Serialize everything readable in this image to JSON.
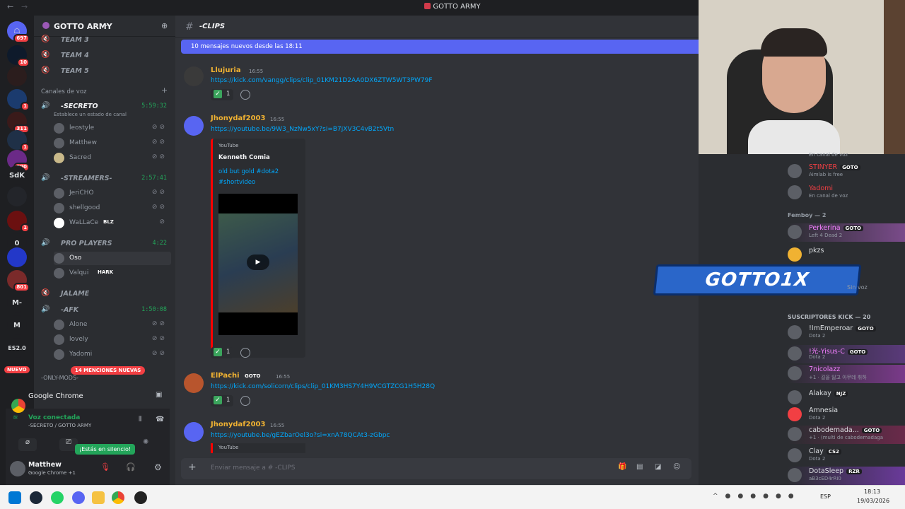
{
  "window": {
    "title": "GOTTO ARMY"
  },
  "rail": {
    "items": [
      {
        "label": "",
        "badge": "697"
      },
      {
        "label": "",
        "badge": "10"
      },
      {
        "label": "",
        "badge": ""
      },
      {
        "label": "",
        "badge": "1"
      },
      {
        "label": "",
        "badge": "311"
      },
      {
        "label": "",
        "badge": "1"
      },
      {
        "label": "",
        "badge": "200"
      },
      {
        "label": "SdK",
        "badge": ""
      },
      {
        "label": "",
        "badge": ""
      },
      {
        "label": "",
        "badge": "1"
      },
      {
        "label": "0",
        "badge": ""
      },
      {
        "label": "",
        "badge": ""
      },
      {
        "label": "",
        "badge": "801"
      },
      {
        "label": "M-",
        "badge": ""
      },
      {
        "label": "M",
        "badge": ""
      },
      {
        "label": "ES2.0",
        "badge": ""
      }
    ],
    "new_badge": "NUEVO"
  },
  "sidebar": {
    "guild_name": "GOTTO ARMY",
    "team_channels": [
      "TEAM 3",
      "TEAM 4",
      "TEAM 5"
    ],
    "voice_category": "Canales de voz",
    "channels": [
      {
        "name": "-SECRETO",
        "time": "5:59:32",
        "status": "Establece un estado de canal",
        "users": [
          "leostyle",
          "Matthew",
          "Sacred"
        ]
      },
      {
        "name": "-STREAMERS-",
        "time": "2:57:41",
        "users": [
          "JeriCHO",
          "shellgood",
          "WaLLaCe"
        ]
      },
      {
        "name": "PRO PLAYERS",
        "time": "4:22",
        "users": [
          "Oso",
          "Valqui"
        ]
      },
      {
        "name": "JALAME",
        "time": "",
        "users": []
      },
      {
        "name": "-AFK",
        "time": "1:50:08",
        "users": [
          "Alone",
          "lovely",
          "Yadomi"
        ]
      }
    ],
    "user_tags": {
      "wallace": "BLZ",
      "valqui": "HARK"
    },
    "mentions_pill": "14 MENCIONES NUEVAS",
    "only_mods": "-ONLY-MODS-"
  },
  "voice_panel": {
    "app": "Google Chrome",
    "status": "Voz conectada",
    "channel": "-SECRETO / GOTTO ARMY",
    "tooltip": "¡Estás en silencio!",
    "username": "Matthew",
    "user_status": "Google Chrome +1"
  },
  "chat": {
    "channel_name": "-CLIPS",
    "new_messages": "10 mensajes nuevos desde las 18:11",
    "messages": [
      {
        "author": "Llujuria",
        "time": "16:55",
        "link": "https://kick.com/vangg/clips/clip_01KM21D2AA0DX6ZTW5WT3PW79F",
        "react_count": "1"
      },
      {
        "author": "Jhonydaf2003",
        "time": "16:55",
        "link": "https://youtube.be/9W3_NzNw5xY?si=B7jXV3C4vB2t5Vtn",
        "react_count": "1"
      },
      {
        "author": "ElPachi",
        "tag": "GOTO",
        "time": "16:55",
        "link": "https://kick.com/solicorn/clips/clip_01KM3HS7Y4H9VCGTZCG1H5H28Q",
        "react_count": "1"
      },
      {
        "author": "Jhonydaf2003",
        "time": "16:55",
        "link": "https://youtube.be/gEZbarOel3o?si=xnA78QCAt3-zGbpc",
        "react_count": ""
      }
    ],
    "embed": {
      "provider": "YouTube",
      "author": "Kenneth Comia",
      "title": "old but gold #dota2 #shortvideo"
    },
    "embed2_provider": "YouTube",
    "composer_placeholder": "Enviar mensaje a # -CLIPS"
  },
  "overlay": {
    "logo_text": "GOTTO1X"
  },
  "members": {
    "top": [
      {
        "name": "",
        "status": "En canal de voz"
      },
      {
        "name": "STINYER",
        "tag": "GOTO",
        "status": "Aimlab is free"
      },
      {
        "name": "Yadomi",
        "status": "En canal de voz"
      }
    ],
    "femboy_header": "Femboy — 2",
    "femboy": [
      {
        "name": "Perkerina",
        "tag": "GOTO",
        "status": "Left 4 Dead 2"
      },
      {
        "name": "pkzs",
        "status": "Sin voz"
      }
    ],
    "kick_header": "SUSCRIPTORES KICK — 20",
    "kick": [
      {
        "name": "!ImEmperoar",
        "tag": "GOTO",
        "status": "Dota 2"
      },
      {
        "name": "!光-Yisus-C",
        "tag": "GOTO",
        "status": "Dota 2"
      },
      {
        "name": "7nicolazz",
        "tag": "",
        "status": "+1 · 길을 잃고 아무데 취하"
      },
      {
        "name": "Alakay",
        "tag": "NJZ",
        "status": ""
      },
      {
        "name": "Amnesia",
        "status": "Dota 2"
      },
      {
        "name": "cabodemada...",
        "tag": "GOTO",
        "status": "+1 · (multi de cabodemadaga"
      },
      {
        "name": "Clay",
        "tag": "CS2",
        "status": "Dota 2"
      },
      {
        "name": "DotaSleep",
        "tag": "RZR",
        "status": "aB3cED4rRi0"
      }
    ]
  },
  "taskbar": {
    "lang": "ESP",
    "time": "18:13",
    "date": "19/03/2026"
  }
}
